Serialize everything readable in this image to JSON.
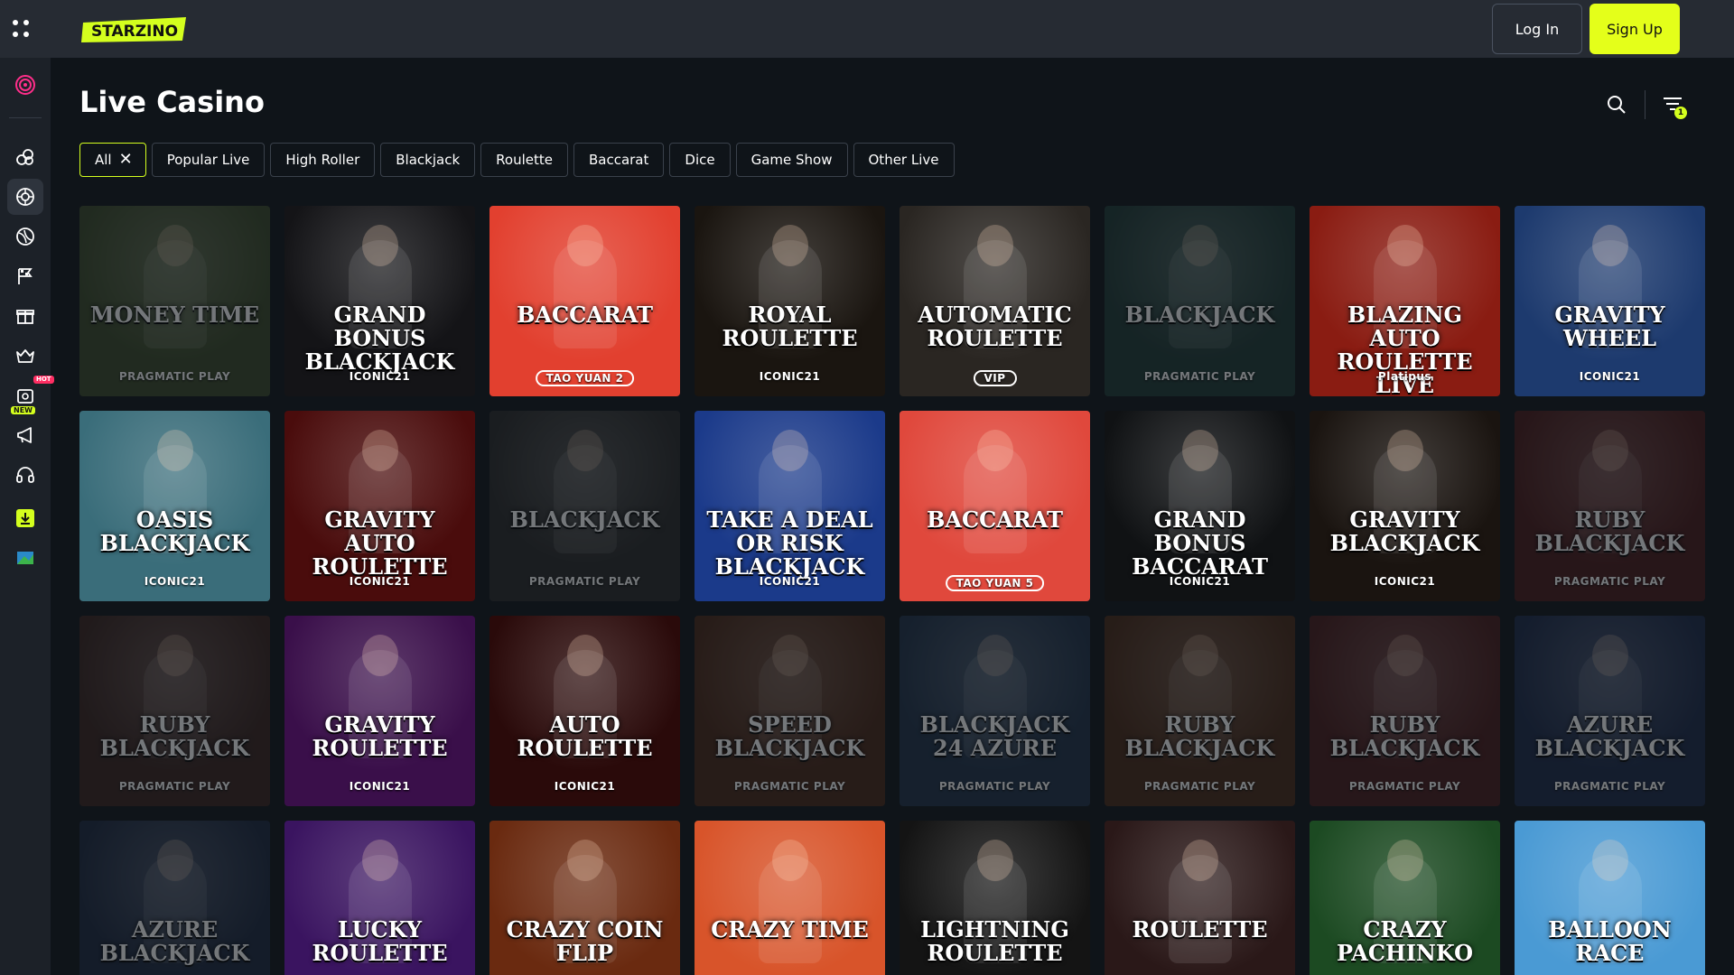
{
  "header": {
    "logo_text": "STARZINO",
    "login_label": "Log In",
    "signup_label": "Sign Up"
  },
  "sidebar": {
    "items": [
      {
        "icon": "target-icon"
      },
      {
        "icon": "dice-icon"
      },
      {
        "icon": "roulette-icon",
        "active": true
      },
      {
        "icon": "sports-ball-icon"
      },
      {
        "icon": "race-flag-icon"
      },
      {
        "icon": "gift-icon"
      },
      {
        "icon": "crown-icon"
      },
      {
        "icon": "promo-box-icon",
        "badge": "HOT"
      },
      {
        "icon": "megaphone-icon",
        "badge": "NEW"
      },
      {
        "icon": "headset-icon"
      },
      {
        "icon": "download-app-icon"
      },
      {
        "icon": "map-flag-icon"
      }
    ]
  },
  "page": {
    "title": "Live Casino",
    "filter_count": "1"
  },
  "filters": [
    {
      "label": "All",
      "active": true
    },
    {
      "label": "Popular Live"
    },
    {
      "label": "High Roller"
    },
    {
      "label": "Blackjack"
    },
    {
      "label": "Roulette"
    },
    {
      "label": "Baccarat"
    },
    {
      "label": "Dice"
    },
    {
      "label": "Game Show"
    },
    {
      "label": "Other Live"
    }
  ],
  "games": [
    {
      "title": "MONEY TIME",
      "subtitle": "PRAGMATIC PLAY",
      "dim": true,
      "bg": "#3b4a2a"
    },
    {
      "title": "GRAND BONUS BLACKJACK",
      "subtitle": "ICONIC21",
      "bg": "#141417"
    },
    {
      "title": "BACCARAT",
      "subtitle": "TAO YUAN 2",
      "bg": "#e2402f",
      "pill": true
    },
    {
      "title": "ROYAL ROULETTE",
      "subtitle": "ICONIC21",
      "bg": "#1a1510"
    },
    {
      "title": "AUTOMATIC ROULETTE",
      "subtitle": "VIP",
      "bg": "#2a2622",
      "pill": true
    },
    {
      "title": "BLACKJACK",
      "subtitle": "PRAGMATIC PLAY",
      "dim": true,
      "bg": "#1f3a36"
    },
    {
      "title": "Blazing Auto Roulette live",
      "subtitle": "Platipus",
      "bg": "#8a1c12"
    },
    {
      "title": "GRAVITY WHEEL",
      "subtitle": "ICONIC21",
      "bg": "#1d3a6e"
    },
    {
      "title": "Oasis BLACKJACK",
      "subtitle": "ICONIC21",
      "bg": "#3a6d7a"
    },
    {
      "title": "GRAVITY AUTO ROULETTE",
      "subtitle": "ICONIC21",
      "bg": "#4a0c0c"
    },
    {
      "title": "BLACKJACK",
      "subtitle": "PRAGMATIC PLAY",
      "dim": true,
      "bg": "#2a2a2a"
    },
    {
      "title": "TAKE A DEAL OR RISK BLACKJACK",
      "subtitle": "ICONIC21",
      "bg": "#1b3a8a"
    },
    {
      "title": "BACCARAT",
      "subtitle": "TAO YUAN 5",
      "bg": "#e0483c",
      "pill": true
    },
    {
      "title": "GRAND BONUS BACCARAT",
      "subtitle": "ICONIC21",
      "bg": "#101214"
    },
    {
      "title": "GRAVITY BLACKJACK",
      "subtitle": "ICONIC21",
      "bg": "#1a1410"
    },
    {
      "title": "Ruby BLACKJACK",
      "subtitle": "PRAGMATIC PLAY",
      "dim": true,
      "bg": "#4a1a1a"
    },
    {
      "title": "Ruby BLACKJACK",
      "subtitle": "PRAGMATIC PLAY",
      "dim": true,
      "bg": "#3a2420"
    },
    {
      "title": "GRAVITY ROULETTE",
      "subtitle": "ICONIC21",
      "bg": "#3a0f4a"
    },
    {
      "title": "AUTO ROULETTE",
      "subtitle": "ICONIC21",
      "bg": "#2a0a0a"
    },
    {
      "title": "SPEED BLACKJACK",
      "subtitle": "PRAGMATIC PLAY",
      "dim": true,
      "bg": "#4a2818"
    },
    {
      "title": "BLACKJACK 24 AZURE",
      "subtitle": "PRAGMATIC PLAY",
      "dim": true,
      "bg": "#20324a"
    },
    {
      "title": "Ruby BLACKJACK",
      "subtitle": "PRAGMATIC PLAY",
      "dim": true,
      "bg": "#4a2a18"
    },
    {
      "title": "Ruby BLACKJACK",
      "subtitle": "PRAGMATIC PLAY",
      "dim": true,
      "bg": "#4a1c1c"
    },
    {
      "title": "Azure BLACKJACK",
      "subtitle": "PRAGMATIC PLAY",
      "dim": true,
      "bg": "#1c2a4a"
    },
    {
      "title": "Azure BLACKJACK",
      "subtitle": "PRAGMATIC PLAY",
      "dim": true,
      "bg": "#1c2840"
    },
    {
      "title": "LUCKY ROULETTE",
      "subtitle": "",
      "bg": "#3a1460"
    },
    {
      "title": "CRAZY COIN FLIP",
      "subtitle": "",
      "bg": "#6a2a10"
    },
    {
      "title": "CRAZY TIME",
      "subtitle": "",
      "bg": "#d8542a"
    },
    {
      "title": "LIGHTNING ROULETTE",
      "subtitle": "",
      "bg": "#141414"
    },
    {
      "title": "Roulette",
      "subtitle": "",
      "bg": "#2a1818"
    },
    {
      "title": "CRAZY PACHINKO",
      "subtitle": "",
      "bg": "#1c4a22"
    },
    {
      "title": "BALLOON RACE",
      "subtitle": "",
      "bg": "#4a9ad4"
    }
  ],
  "colors": {
    "accent": "#d4ff1e",
    "topbar": "#262b33",
    "sidebar": "#1c2128",
    "background": "#0f1419"
  }
}
